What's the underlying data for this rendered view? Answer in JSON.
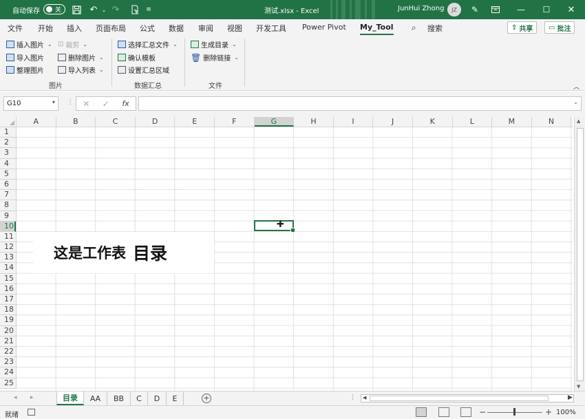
{
  "titlebar": {
    "autosave_label": "自动保存",
    "autosave_state": "关",
    "document_title": "测试.xlsx  -  Excel",
    "user_name": "JunHui Zhong",
    "user_initials": "JZ"
  },
  "tabs": [
    "文件",
    "开始",
    "插入",
    "页面布局",
    "公式",
    "数据",
    "审阅",
    "视图",
    "开发工具",
    "Power Pivot",
    "My_Tool"
  ],
  "tab_search": "搜索",
  "share_label": "共享",
  "comment_label": "批注",
  "ribbon": {
    "group_picture": {
      "label": "图片",
      "insert_picture": "插入图片",
      "import_picture": "导入图片",
      "organize_picture": "整理图片",
      "crop": "裁剪",
      "delete_picture": "删除图片",
      "import_list": "导入列表"
    },
    "group_summary": {
      "label": "数据汇总",
      "select_summary_file": "选择汇总文件",
      "confirm_template": "确认模板",
      "set_summary_range": "设置汇总区域"
    },
    "group_file": {
      "label": "文件",
      "generate_toc": "生成目录",
      "delete_links": "删除链接"
    }
  },
  "formula_bar": {
    "name_box": "G10",
    "fx_label": "fx",
    "formula": ""
  },
  "grid": {
    "columns": [
      "A",
      "B",
      "C",
      "D",
      "E",
      "F",
      "G",
      "H",
      "I",
      "J",
      "K",
      "L",
      "M",
      "N"
    ],
    "rows": [
      "1",
      "2",
      "3",
      "4",
      "5",
      "6",
      "7",
      "8",
      "9",
      "10",
      "11",
      "12",
      "13",
      "14",
      "15",
      "16",
      "17",
      "18",
      "19",
      "20",
      "21",
      "22",
      "23",
      "24",
      "25"
    ],
    "selected_column": "G",
    "selected_row": "10",
    "textbox_main": "这是工作表",
    "textbox_big": "目录"
  },
  "sheets": [
    "目录",
    "AA",
    "BB",
    "C",
    "D",
    "E"
  ],
  "active_sheet": "目录",
  "statusbar": {
    "ready": "就绪",
    "zoom": "100%"
  },
  "colors": {
    "accent": "#217346"
  }
}
